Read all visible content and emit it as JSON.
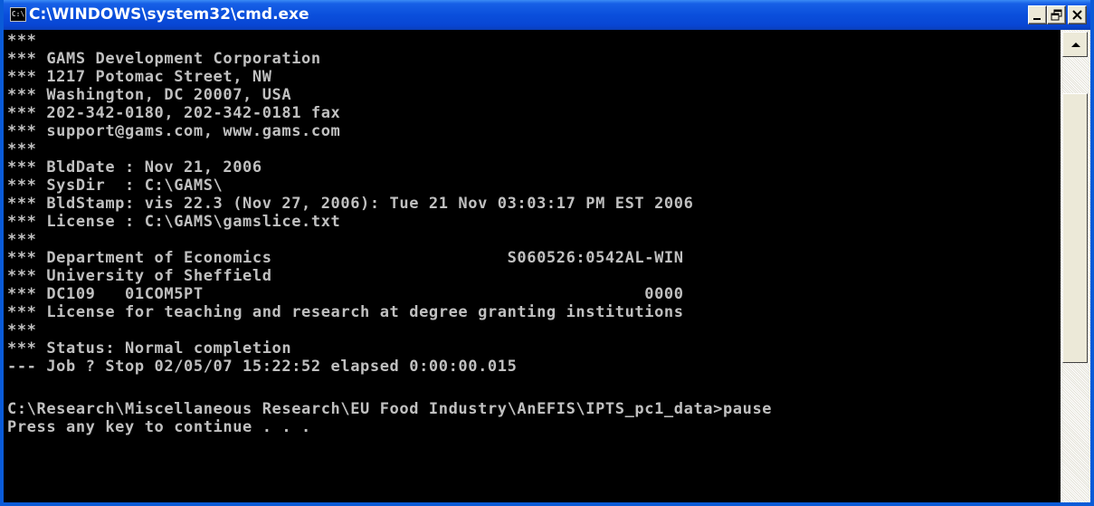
{
  "window": {
    "title": "C:\\WINDOWS\\system32\\cmd.exe",
    "app_icon_label": "C:\\",
    "buttons": {
      "minimize": "minimize",
      "maximize": "maximize",
      "close": "close"
    }
  },
  "console": {
    "text_color": "#c0c0c0",
    "background": "#000000",
    "lines": [
      "***",
      "*** GAMS Development Corporation",
      "*** 1217 Potomac Street, NW",
      "*** Washington, DC 20007, USA",
      "*** 202-342-0180, 202-342-0181 fax",
      "*** support@gams.com, www.gams.com",
      "***",
      "*** BldDate : Nov 21, 2006",
      "*** SysDir  : C:\\GAMS\\",
      "*** BldStamp: vis 22.3 (Nov 27, 2006): Tue 21 Nov 03:03:17 PM EST 2006",
      "*** License : C:\\GAMS\\gamslice.txt",
      "***",
      "*** Department of Economics                        S060526:0542AL-WIN",
      "*** University of Sheffield",
      "*** DC109   01COM5PT                                             0000",
      "*** License for teaching and research at degree granting institutions",
      "***",
      "*** Status: Normal completion",
      "--- Job ? Stop 02/05/07 15:22:52 elapsed 0:00:00.015",
      "",
      "C:\\Research\\Miscellaneous Research\\EU Food Industry\\AnEFIS\\IPTS_pc1_data>pause",
      "Press any key to continue . . ."
    ]
  },
  "colors": {
    "titlebar_accent": "#0a4fdc",
    "frame": "#0a5bd8",
    "button_face": "#ece9d8",
    "close_glyph": "#000000"
  }
}
